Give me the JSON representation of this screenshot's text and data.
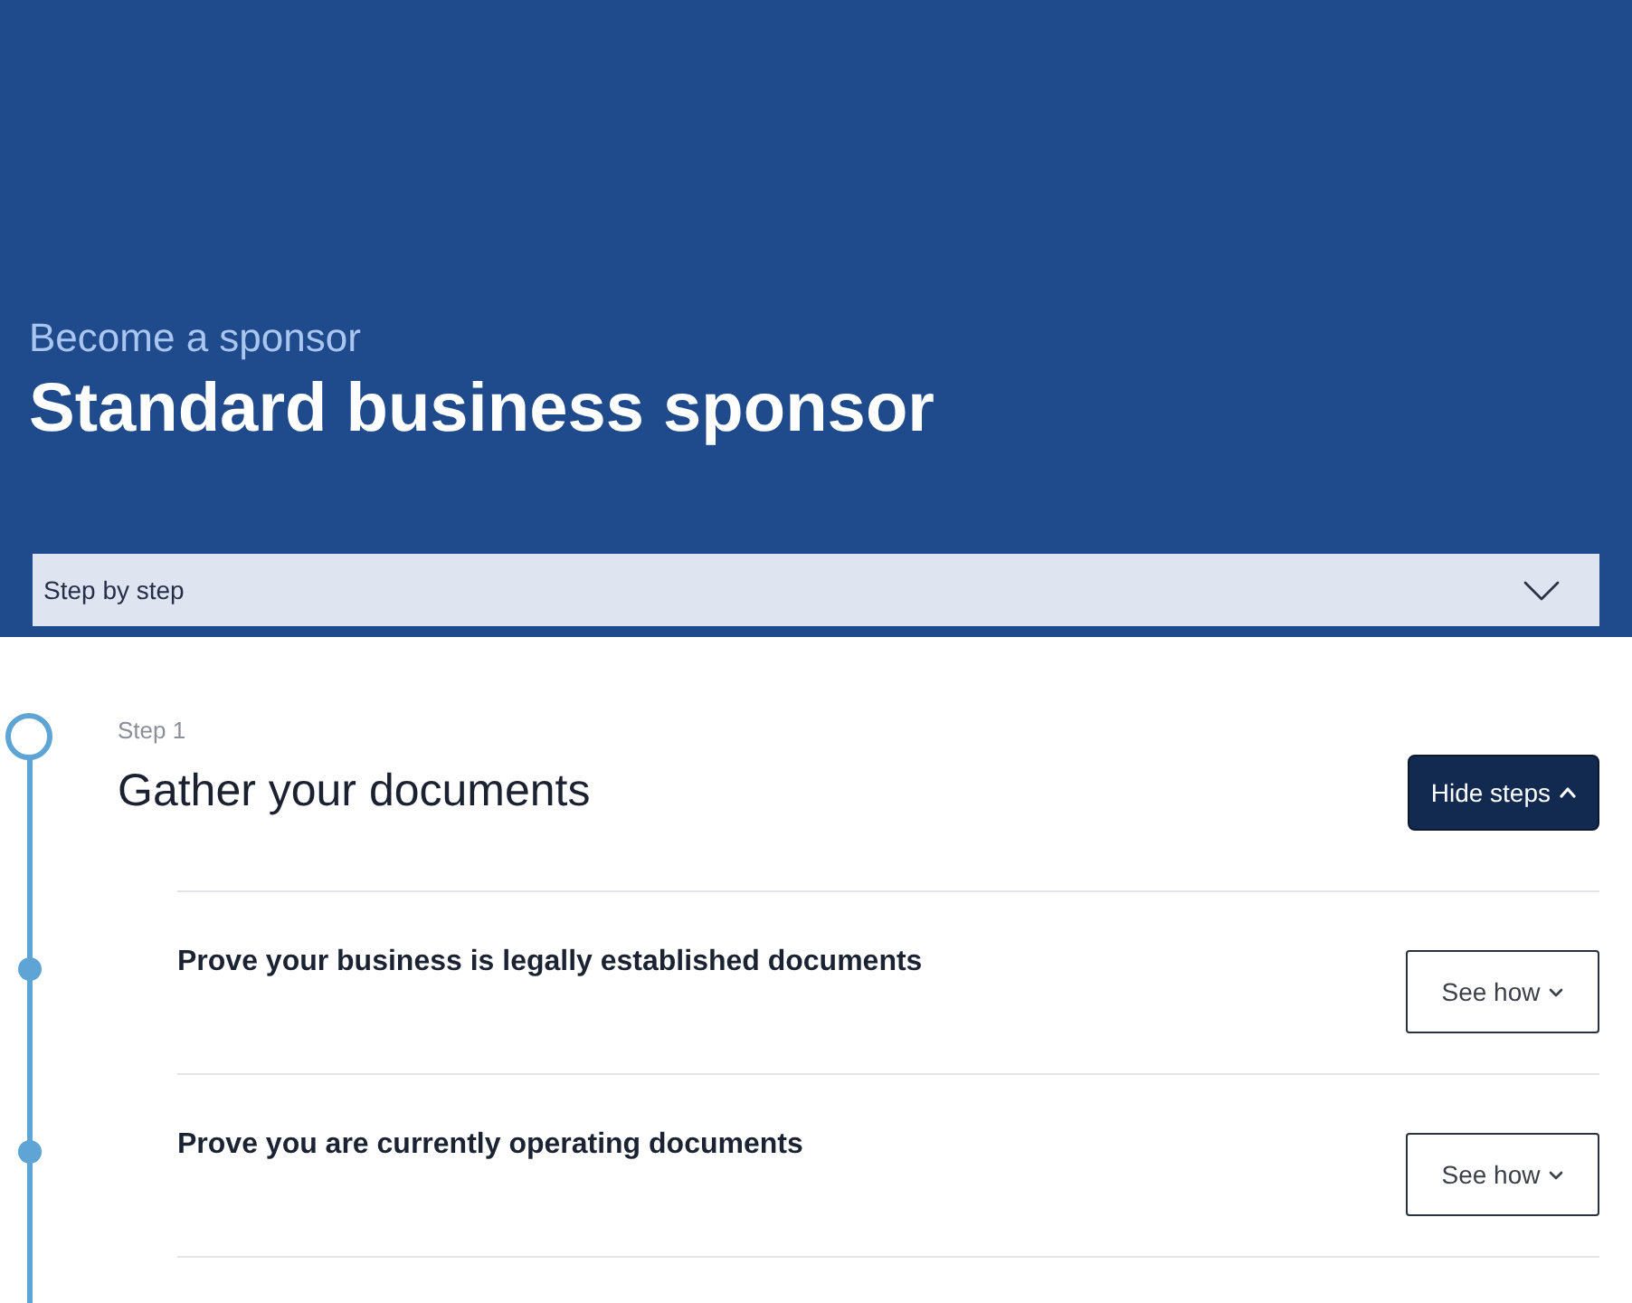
{
  "header": {
    "eyebrow": "Become a sponsor",
    "title": "Standard business sponsor"
  },
  "section_menu": {
    "label": "Step by step",
    "expanded": false
  },
  "steps": [
    {
      "label": "Step 1",
      "title": "Gather your documents",
      "expanded": true,
      "toggle_label": "Hide steps",
      "items": [
        {
          "title": "Prove your business is legally established documents",
          "expanded": false,
          "toggle_label": "See how"
        },
        {
          "title": "Prove you are currently operating documents",
          "expanded": false,
          "toggle_label": "See how"
        }
      ]
    }
  ]
}
